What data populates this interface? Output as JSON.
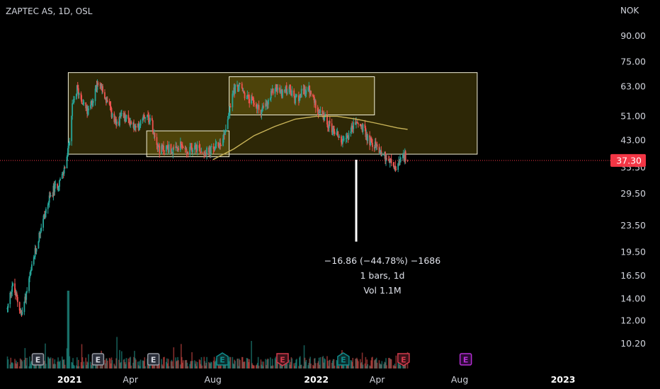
{
  "header": {
    "title": "ZAPTEC AS, 1D, OSL",
    "currency": "NOK"
  },
  "colors": {
    "background": "#000000",
    "up": "#26a69a",
    "down": "#ef5350",
    "ma": "#c9b458",
    "box_fill": "rgba(160,140,20,0.28)",
    "box_stroke": "#f2f0d8",
    "price_tag": "#f23645",
    "dividend_badge": "#0f8c8c",
    "earnings_badge": "#d33a4c",
    "future_badge": "#b62fd6"
  },
  "price_tag": {
    "value": "37.30"
  },
  "measurement": {
    "change": "−16.86 (−44.78%) −1686",
    "bars": "1 bars, 1d",
    "volume": "Vol 1.1M"
  },
  "chart_data": {
    "type": "candlestick",
    "title": "ZAPTEC AS, 1D, OSL",
    "y_scale": "log",
    "ylim": [
      9.5,
      100
    ],
    "y_ticks": [
      "90.00",
      "75.00",
      "63.00",
      "51.00",
      "43.00",
      "35.50",
      "29.50",
      "23.50",
      "19.50",
      "16.50",
      "14.00",
      "12.00",
      "10.20"
    ],
    "x_ticks": [
      {
        "label": "2021",
        "date": "2021-01-01"
      },
      {
        "label": "Apr",
        "date": "2021-04-01"
      },
      {
        "label": "Aug",
        "date": "2021-08-01"
      },
      {
        "label": "2022",
        "date": "2022-01-01"
      },
      {
        "label": "Apr",
        "date": "2022-04-01"
      },
      {
        "label": "Aug",
        "date": "2022-08-01"
      },
      {
        "label": "2023",
        "date": "2023-01-01"
      }
    ],
    "xlim": [
      "2020-09-20",
      "2023-03-10"
    ],
    "last_price": 37.3,
    "price_path": [
      [
        "2020-10-01",
        13.0
      ],
      [
        "2020-10-08",
        15.5
      ],
      [
        "2020-10-15",
        14.0
      ],
      [
        "2020-10-22",
        12.5
      ],
      [
        "2020-11-01",
        15.5
      ],
      [
        "2020-11-10",
        19.0
      ],
      [
        "2020-11-20",
        23.5
      ],
      [
        "2020-11-30",
        27.5
      ],
      [
        "2020-12-07",
        30.0
      ],
      [
        "2020-12-14",
        31.5
      ],
      [
        "2020-12-22",
        33.5
      ],
      [
        "2020-12-30",
        40.0
      ],
      [
        "2021-01-05",
        54.0
      ],
      [
        "2021-01-12",
        62.0
      ],
      [
        "2021-01-20",
        57.0
      ],
      [
        "2021-01-28",
        52.0
      ],
      [
        "2021-02-05",
        58.0
      ],
      [
        "2021-02-12",
        66.0
      ],
      [
        "2021-02-20",
        60.0
      ],
      [
        "2021-03-01",
        54.0
      ],
      [
        "2021-03-10",
        48.0
      ],
      [
        "2021-03-20",
        51.0
      ],
      [
        "2021-04-01",
        49.0
      ],
      [
        "2021-04-10",
        46.0
      ],
      [
        "2021-04-20",
        52.0
      ],
      [
        "2021-05-01",
        50.0
      ],
      [
        "2021-05-08",
        44.0
      ],
      [
        "2021-05-15",
        40.0
      ],
      [
        "2021-05-25",
        41.0
      ],
      [
        "2021-06-05",
        39.5
      ],
      [
        "2021-06-15",
        41.5
      ],
      [
        "2021-06-25",
        39.0
      ],
      [
        "2021-07-05",
        42.0
      ],
      [
        "2021-07-15",
        40.0
      ],
      [
        "2021-07-25",
        39.5
      ],
      [
        "2021-08-05",
        41.0
      ],
      [
        "2021-08-15",
        43.0
      ],
      [
        "2021-08-25",
        52.0
      ],
      [
        "2021-09-01",
        62.0
      ],
      [
        "2021-09-10",
        63.0
      ],
      [
        "2021-09-20",
        58.0
      ],
      [
        "2021-10-01",
        56.0
      ],
      [
        "2021-10-10",
        53.0
      ],
      [
        "2021-10-20",
        55.0
      ],
      [
        "2021-11-01",
        63.0
      ],
      [
        "2021-11-10",
        60.0
      ],
      [
        "2021-11-20",
        62.0
      ],
      [
        "2021-12-01",
        57.0
      ],
      [
        "2021-12-10",
        60.0
      ],
      [
        "2021-12-20",
        62.0
      ],
      [
        "2022-01-01",
        55.0
      ],
      [
        "2022-01-10",
        51.0
      ],
      [
        "2022-01-20",
        48.0
      ],
      [
        "2022-02-01",
        45.0
      ],
      [
        "2022-02-10",
        42.0
      ],
      [
        "2022-02-20",
        46.0
      ],
      [
        "2022-03-01",
        49.0
      ],
      [
        "2022-03-10",
        47.0
      ],
      [
        "2022-03-20",
        43.0
      ],
      [
        "2022-04-01",
        41.0
      ],
      [
        "2022-04-10",
        39.0
      ],
      [
        "2022-04-20",
        37.0
      ],
      [
        "2022-04-28",
        35.0
      ],
      [
        "2022-05-05",
        37.0
      ],
      [
        "2022-05-12",
        38.5
      ],
      [
        "2022-05-16",
        37.3
      ]
    ],
    "moving_average": [
      [
        "2021-08-01",
        37.5
      ],
      [
        "2021-09-01",
        40.5
      ],
      [
        "2021-10-01",
        44.5
      ],
      [
        "2021-11-01",
        47.5
      ],
      [
        "2021-12-01",
        50.0
      ],
      [
        "2022-01-01",
        51.0
      ],
      [
        "2022-02-01",
        51.0
      ],
      [
        "2022-03-01",
        50.0
      ],
      [
        "2022-04-01",
        48.5
      ],
      [
        "2022-05-01",
        47.0
      ],
      [
        "2022-05-16",
        46.5
      ]
    ],
    "rectangles": [
      {
        "from": "2020-12-30",
        "to": "2022-08-27",
        "high": 69.5,
        "low": 39.0
      },
      {
        "from": "2021-04-25",
        "to": "2021-08-25",
        "high": 46.0,
        "low": 38.3
      },
      {
        "from": "2021-08-25",
        "to": "2022-03-28",
        "high": 67.5,
        "low": 51.5
      }
    ],
    "measure_line": {
      "date": "2022-03-01",
      "from": 37.5,
      "to": 21.0
    },
    "events": [
      {
        "date": "2020-11-15",
        "type": "earnings",
        "label": "E",
        "state": "past"
      },
      {
        "date": "2021-02-12",
        "type": "earnings",
        "label": "E",
        "state": "past"
      },
      {
        "date": "2021-05-05",
        "type": "earnings",
        "label": "E",
        "state": "past"
      },
      {
        "date": "2021-08-15",
        "type": "earnings",
        "label": "E",
        "state": "positive"
      },
      {
        "date": "2021-11-12",
        "type": "earnings",
        "label": "E",
        "state": "negative"
      },
      {
        "date": "2022-02-10",
        "type": "earnings",
        "label": "E",
        "state": "positive"
      },
      {
        "date": "2022-05-10",
        "type": "earnings",
        "label": "E",
        "state": "negative"
      },
      {
        "date": "2022-08-10",
        "type": "earnings",
        "label": "E",
        "state": "future"
      }
    ]
  }
}
